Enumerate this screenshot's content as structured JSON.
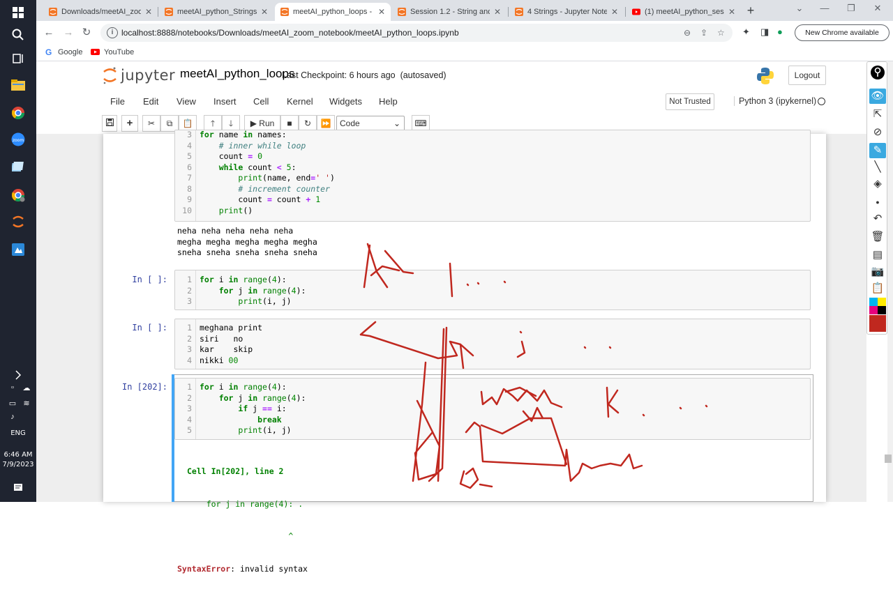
{
  "taskbar": {
    "time": "6:46 AM",
    "date": "7/9/2023",
    "lang": "ENG"
  },
  "browser": {
    "tabs": [
      {
        "title": "Downloads/meetAI_zoom_",
        "icon": "jupyter-tab-icon"
      },
      {
        "title": "meetAI_python_Strings - ",
        "icon": "jupyter-tab-icon"
      },
      {
        "title": "meetAI_python_loops - Ju",
        "icon": "jupyter-tab-icon",
        "active": true
      },
      {
        "title": "Session 1.2 - String and I",
        "icon": "jupyter-tab-icon"
      },
      {
        "title": "4 Strings - Jupyter Noteb",
        "icon": "jupyter-tab-icon"
      },
      {
        "title": "(1) meetAI_python_sessio",
        "icon": "youtube-tab-icon"
      }
    ],
    "url": "localhost:8888/notebooks/Downloads/meetAI_zoom_notebook/meetAI_python_loops.ipynb",
    "new_chrome": "New Chrome available",
    "bookmarks": [
      {
        "label": "Google"
      },
      {
        "label": "YouTube"
      }
    ]
  },
  "jupyter": {
    "logo_text": "jupyter",
    "notebook_name": "meetAI_python_loops",
    "checkpoint": "Last Checkpoint: 6 hours ago",
    "autosave": "(autosaved)",
    "logout": "Logout",
    "menu": [
      "File",
      "Edit",
      "View",
      "Insert",
      "Cell",
      "Kernel",
      "Widgets",
      "Help"
    ],
    "trust": "Not Trusted",
    "kernel": "Python 3 (ipykernel)",
    "run_label": "Run",
    "cell_type": "Code"
  },
  "cells": {
    "cell1": {
      "line_numbers": [
        "3",
        "4",
        "5",
        "6",
        "7",
        "8",
        "9",
        "10"
      ],
      "output": [
        "neha neha neha neha neha",
        "megha megha megha megha megha",
        "sneha sneha sneha sneha sneha"
      ]
    },
    "cell2": {
      "prompt": "In [ ]:",
      "line_numbers": [
        "1",
        "2",
        "3"
      ]
    },
    "cell3": {
      "prompt": "In [ ]:",
      "line_numbers": [
        "1",
        "2",
        "3",
        "4"
      ],
      "lines": [
        "meghana print",
        "siri   no",
        "kar    skip",
        "nikki "
      ],
      "line4_num": "00"
    },
    "cell4": {
      "prompt": "In [202]:",
      "line_numbers": [
        "1",
        "2",
        "3",
        "4",
        "5"
      ],
      "error_location": "Cell In[202], line 2",
      "error_code": "    for j in range(4): .",
      "error_caret": "                     ^",
      "error_name": "SyntaxError",
      "error_msg": ": invalid syntax"
    }
  },
  "colors": {
    "ink": "#c0281f",
    "jupyter_orange": "#f37626",
    "prompt_blue": "#303f9f",
    "selected_blue": "#42a5f5"
  }
}
